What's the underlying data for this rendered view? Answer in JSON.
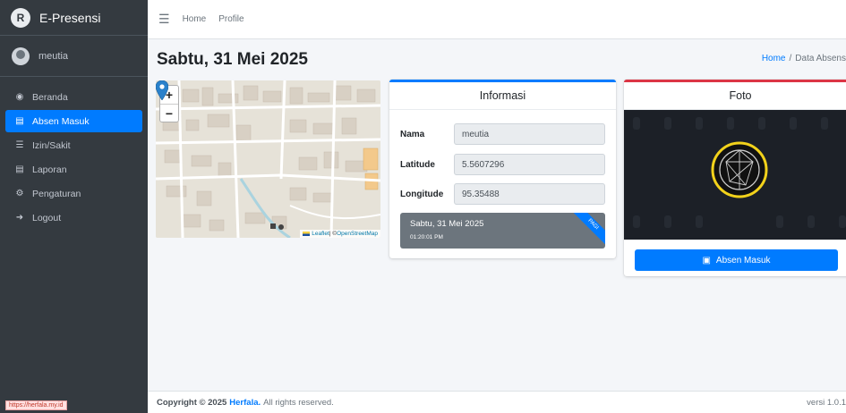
{
  "app": {
    "brand_name": "E-Presensi",
    "brand_logo_letter": "R"
  },
  "user": {
    "name": "meutia"
  },
  "sidebar": {
    "items": [
      {
        "label": "Beranda",
        "icon": "tachometer-icon",
        "glyph": "◉",
        "active": false
      },
      {
        "label": "Absen Masuk",
        "icon": "calendar-icon",
        "glyph": "▤",
        "active": true
      },
      {
        "label": "Izin/Sakit",
        "icon": "database-icon",
        "glyph": "☰",
        "active": false
      },
      {
        "label": "Laporan",
        "icon": "report-icon",
        "glyph": "▤",
        "active": false
      },
      {
        "label": "Pengaturan",
        "icon": "gears-icon",
        "glyph": "⚙",
        "active": false
      },
      {
        "label": "Logout",
        "icon": "sign-out-icon",
        "glyph": "➜",
        "active": false
      }
    ],
    "status_url": "https://herfala.my.id"
  },
  "topbar": {
    "menu_icon": "☰",
    "links": [
      "Home",
      "Profile"
    ]
  },
  "header": {
    "title": "Sabtu, 31 Mei 2025",
    "breadcrumb_home": "Home",
    "breadcrumb_sep": "/",
    "breadcrumb_current": "Data Absens"
  },
  "map": {
    "zoom_in": "+",
    "zoom_out": "−",
    "attribution_leaflet": "Leaflet",
    "attribution_sep": " | © ",
    "attribution_osm": "OpenStreetMap"
  },
  "info": {
    "title": "Informasi",
    "fields": [
      {
        "label": "Nama",
        "value": "meutia"
      },
      {
        "label": "Latitude",
        "value": "5.5607296"
      },
      {
        "label": "Longitude",
        "value": "95.35488"
      }
    ],
    "date": "Sabtu, 31 Mei 2025",
    "time": "01:20:01 PM",
    "ribbon": "PAGI"
  },
  "foto": {
    "title": "Foto",
    "button_label": "Absen Masuk"
  },
  "footer": {
    "copyright_prefix": "Copyright © 2025",
    "brand": "Herfala.",
    "rights": "All rights reserved.",
    "version": "versi 1.0.1"
  },
  "colors": {
    "primary": "#007bff",
    "danger": "#dc3545",
    "sidebar_bg": "#343a40",
    "secondary": "#6c757d"
  }
}
